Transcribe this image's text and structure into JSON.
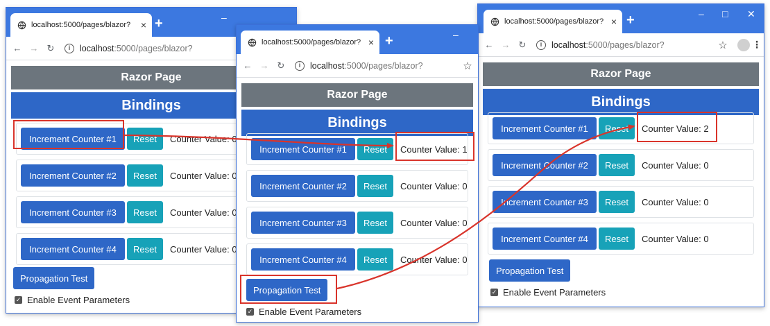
{
  "browser": {
    "tab_title": "localhost:5000/pages/blazor?",
    "tab_close": "×",
    "new_tab": "+",
    "url_host": "localhost",
    "url_path": ":5000/pages/blazor?",
    "minimize": "–",
    "maximize": "□",
    "close": "✕"
  },
  "page": {
    "razor_header": "Razor Page",
    "bindings_header": "Bindings",
    "reset_label": "Reset",
    "propagation_label": "Propagation Test",
    "enable_event_label": "Enable Event Parameters",
    "increment_labels": [
      "Increment Counter #1",
      "Increment Counter #2",
      "Increment Counter #3",
      "Increment Counter #4"
    ]
  },
  "windows": [
    {
      "counter_values": [
        "Counter Value: 0",
        "Counter Value: 0",
        "Counter Value: 0",
        "Counter Value: 0"
      ]
    },
    {
      "counter_values": [
        "Counter Value: 1",
        "Counter Value: 0",
        "Counter Value: 0",
        "Counter Value: 0"
      ]
    },
    {
      "counter_values": [
        "Counter Value: 2",
        "Counter Value: 0",
        "Counter Value: 0",
        "Counter Value: 0"
      ]
    }
  ],
  "colors": {
    "tab_strip": "#3c78e0",
    "primary": "#2e67c7",
    "info": "#17a2b8",
    "secondary": "#6c757d",
    "annotation": "#d9342b"
  }
}
